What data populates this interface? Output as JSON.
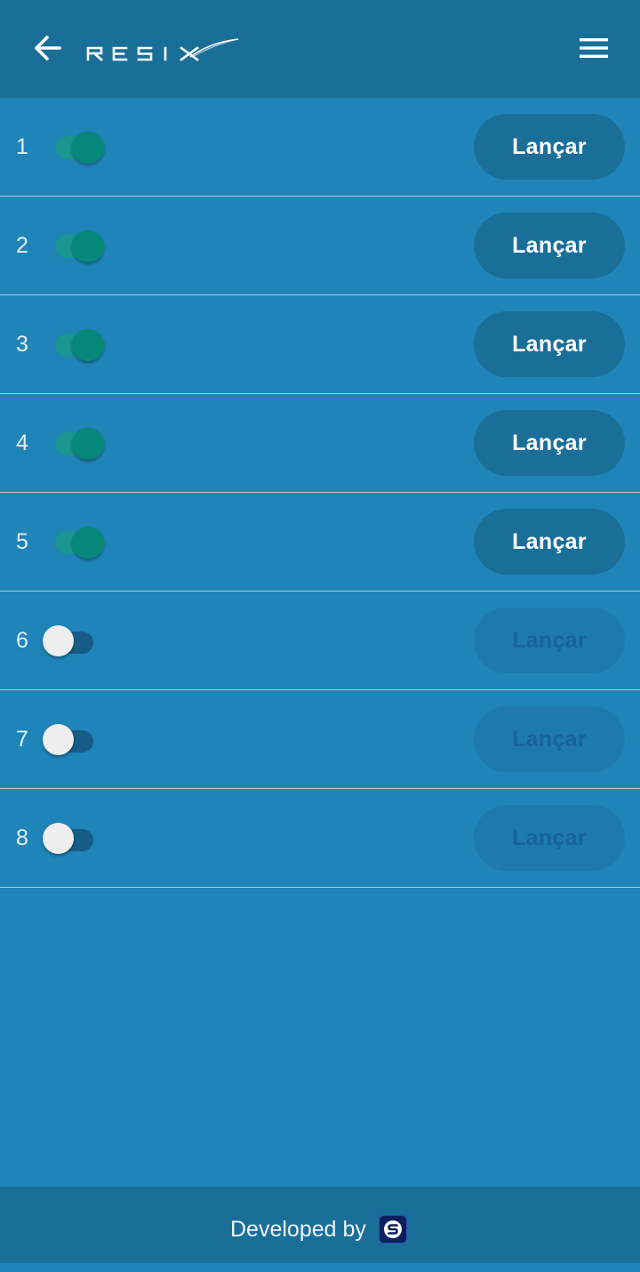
{
  "header": {
    "brand": "RESIX",
    "back_icon": "arrow-left-icon",
    "menu_icon": "hamburger-menu-icon"
  },
  "rows": [
    {
      "number": "1",
      "enabled": true,
      "button_label": "Lançar"
    },
    {
      "number": "2",
      "enabled": true,
      "button_label": "Lançar"
    },
    {
      "number": "3",
      "enabled": true,
      "button_label": "Lançar"
    },
    {
      "number": "4",
      "enabled": true,
      "button_label": "Lançar"
    },
    {
      "number": "5",
      "enabled": true,
      "button_label": "Lançar"
    },
    {
      "number": "6",
      "enabled": false,
      "button_label": "Lançar"
    },
    {
      "number": "7",
      "enabled": false,
      "button_label": "Lançar"
    },
    {
      "number": "8",
      "enabled": false,
      "button_label": "Lançar"
    }
  ],
  "footer": {
    "text": "Developed by",
    "logo_icon": "s-logo-icon"
  },
  "colors": {
    "background": "#1f84b8",
    "header_footer": "#1a6f99",
    "toggle_on_thumb": "#05887a",
    "toggle_off_thumb": "#eeeeee",
    "button_enabled_text": "#ffffff",
    "button_disabled_text": "#17649a"
  }
}
